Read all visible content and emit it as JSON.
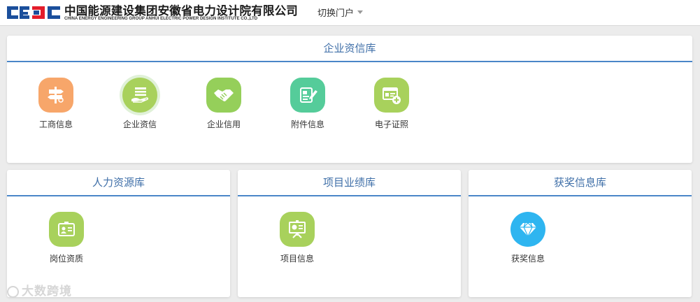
{
  "header": {
    "logo_cn": "中国能源建设集团安徽省电力设计院有限公司",
    "logo_en": "CHINA ENERGY ENGINEERING GROUP ANHUI ELECTRIC POWER DESIGN INSTITUTE CO.,LTD",
    "portal_switch_label": "切换门户",
    "brand_color": "#1b4f9c",
    "brand_accent": "#e31d2b"
  },
  "panels": {
    "enterprise": {
      "title": "企业资信库",
      "tiles": [
        {
          "label": "工商信息",
          "icon": "signpost-icon",
          "color": "#f7a66a"
        },
        {
          "label": "企业资信",
          "icon": "hand-document-icon",
          "color": "#a8d15c"
        },
        {
          "label": "企业信用",
          "icon": "handshake-icon",
          "color": "#95cf5a"
        },
        {
          "label": "附件信息",
          "icon": "edit-document-icon",
          "color": "#55cc9a"
        },
        {
          "label": "电子证照",
          "icon": "certificate-add-icon",
          "color": "#a8d15c"
        }
      ]
    },
    "hr": {
      "title": "人力资源库",
      "tiles": [
        {
          "label": "岗位资质",
          "icon": "id-card-icon",
          "color": "#a8d15c"
        }
      ]
    },
    "project": {
      "title": "项目业绩库",
      "tiles": [
        {
          "label": "项目信息",
          "icon": "presentation-board-icon",
          "color": "#a8d15c"
        }
      ]
    },
    "awards": {
      "title": "获奖信息库",
      "tiles": [
        {
          "label": "获奖信息",
          "icon": "diamond-icon",
          "color": "#2eb5f0"
        }
      ]
    }
  },
  "watermark": {
    "text": "大数跨境"
  }
}
